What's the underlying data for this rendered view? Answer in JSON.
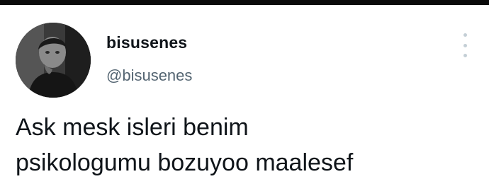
{
  "tweet": {
    "author": {
      "display_name": "bisusenes",
      "handle": "@bisusenes",
      "avatar_icon": "profile-photo"
    },
    "more_icon": "vertical-ellipsis-icon",
    "text_lines": [
      "Ask mesk isleri benim",
      "psikologumu bozuyoo maalesef"
    ]
  },
  "colors": {
    "top_bar": "#0b0b0b",
    "name": "#0f1419",
    "handle": "#536471",
    "text": "#0f1419",
    "more_dots": "#c4cfd6"
  }
}
